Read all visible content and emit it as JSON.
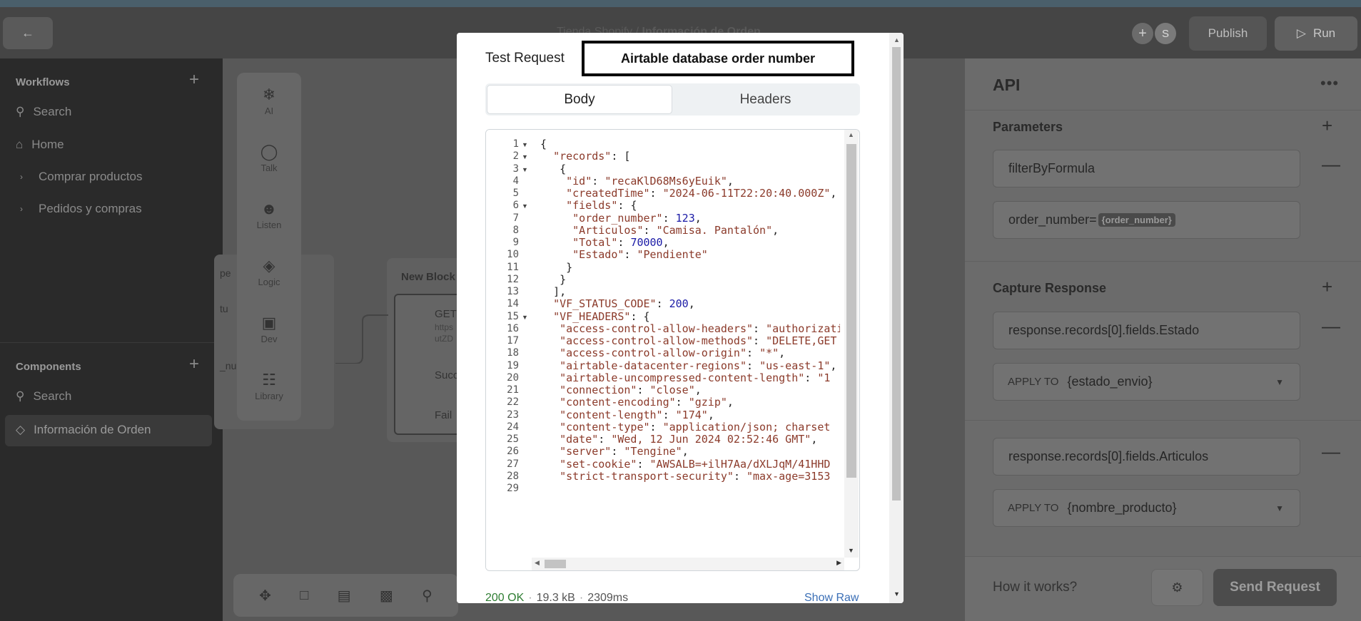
{
  "topbar": {
    "breadcrumb_project": "Tienda Shopify",
    "breadcrumb_sep": "/",
    "breadcrumb_page": "Información de Orden",
    "avatar_letter": "S",
    "publish_label": "Publish",
    "run_label": "Run"
  },
  "sidebar": {
    "workflows_title": "Workflows",
    "search_placeholder": "Search",
    "items": [
      {
        "label": "Home"
      },
      {
        "label": "Comprar productos"
      },
      {
        "label": "Pedidos y compras"
      }
    ],
    "components_title": "Components",
    "components_search_placeholder": "Search",
    "component_items": [
      {
        "label": "Información de Orden"
      }
    ]
  },
  "toolbox": {
    "items": [
      {
        "label": "AI",
        "icon": "ai-icon"
      },
      {
        "label": "Talk",
        "icon": "talk-icon"
      },
      {
        "label": "Listen",
        "icon": "listen-icon"
      },
      {
        "label": "Logic",
        "icon": "logic-icon"
      },
      {
        "label": "Dev",
        "icon": "dev-icon"
      },
      {
        "label": "Library",
        "icon": "library-icon"
      }
    ]
  },
  "canvas": {
    "node2_title": "New Block",
    "node2_method": "GET",
    "node2_url1": "https",
    "node2_url2": "utZD",
    "node2_success": "Succe",
    "node2_fail": "Fail",
    "node1_frag1": "pe",
    "node1_frag2": "tu",
    "node1_frag3": "_nu"
  },
  "right_panel": {
    "title": "API",
    "parameters_title": "Parameters",
    "param_key": "filterByFormula",
    "param_value_prefix": "order_number=",
    "param_value_tag": "{order_number}",
    "capture_title": "Capture Response",
    "captures": [
      {
        "path": "response.records[0].fields.Estado",
        "apply_label": "APPLY TO",
        "variable": "{estado_envio}"
      },
      {
        "path": "response.records[0].fields.Articulos",
        "apply_label": "APPLY TO",
        "variable": "{nombre_producto}"
      }
    ],
    "how_it_works": "How it works?",
    "send_label": "Send Request"
  },
  "modal": {
    "tab_label": "Test Request",
    "annotation": "Airtable database order number",
    "seg_body": "Body",
    "seg_headers": "Headers",
    "status_code": "200 OK",
    "size": "19.3 kB",
    "time": "2309ms",
    "show_raw": "Show Raw",
    "code_lines": [
      "{",
      "  \"records\": [",
      "   {",
      "    \"id\": \"recaKlD68Ms6yEuik\",",
      "    \"createdTime\": \"2024-06-11T22:20:40.000Z\",",
      "    \"fields\": {",
      "     \"order_number\": 123,",
      "     \"Articulos\": \"Camisa. Pantalón\",",
      "     \"Total\": 70000,",
      "     \"Estado\": \"Pendiente\"",
      "    }",
      "   }",
      "  ],",
      "  \"VF_STATUS_CODE\": 200,",
      "  \"VF_HEADERS\": {",
      "   \"access-control-allow-headers\": \"authorization",
      "   \"access-control-allow-methods\": \"DELETE,GET",
      "   \"access-control-allow-origin\": \"*\",",
      "   \"airtable-datacenter-regions\": \"us-east-1\",",
      "   \"airtable-uncompressed-content-length\": \"1",
      "   \"connection\": \"close\",",
      "   \"content-encoding\": \"gzip\",",
      "   \"content-length\": \"174\",",
      "   \"content-type\": \"application/json; charset",
      "   \"date\": \"Wed, 12 Jun 2024 02:52:46 GMT\",",
      "   \"server\": \"Tengine\",",
      "   \"set-cookie\": \"AWSALB=+ilH7Aa/dXLJqM/41HHD",
      "   \"strict-transport-security\": \"max-age=3153",
      ""
    ],
    "foldable_lines": [
      1,
      2,
      3,
      6,
      15
    ]
  }
}
